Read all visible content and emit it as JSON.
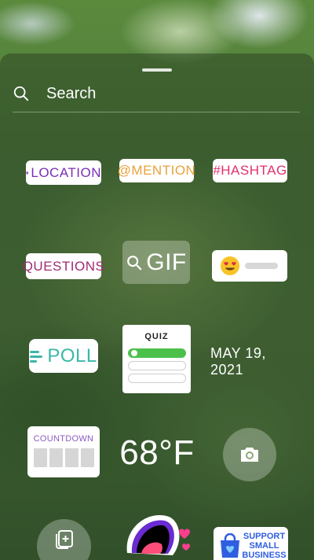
{
  "search": {
    "placeholder": "Search"
  },
  "stickers": {
    "location": "LOCATION",
    "mention": "@MENTION",
    "hashtag": "#HASHTAG",
    "questions": "QUESTIONS",
    "gif": "GIF",
    "emoji_slider": {
      "emoji": "heart-eyes-emoji"
    },
    "poll": "POLL",
    "quiz": {
      "title": "QUIZ"
    },
    "date": "MAY 19, 2021",
    "countdown": "COUNTDOWN",
    "temperature": "68°F",
    "camera": {
      "icon": "camera-icon"
    },
    "add_yours": {
      "icon": "add-photo-icon"
    },
    "mouth": {
      "icon": "mouth-sticker-icon"
    },
    "support_small_business": [
      "SUPPORT",
      "SMALL",
      "BUSINESS"
    ]
  },
  "colors": {
    "location": "#7a2eb6",
    "mention": "#e9a23b",
    "hashtag": "#e1306c",
    "questions": "#a02b74",
    "poll": "#3bb7a8",
    "quiz_correct": "#4cc14a",
    "countdown": "#8b5cc2",
    "business": "#2f5ee0"
  }
}
